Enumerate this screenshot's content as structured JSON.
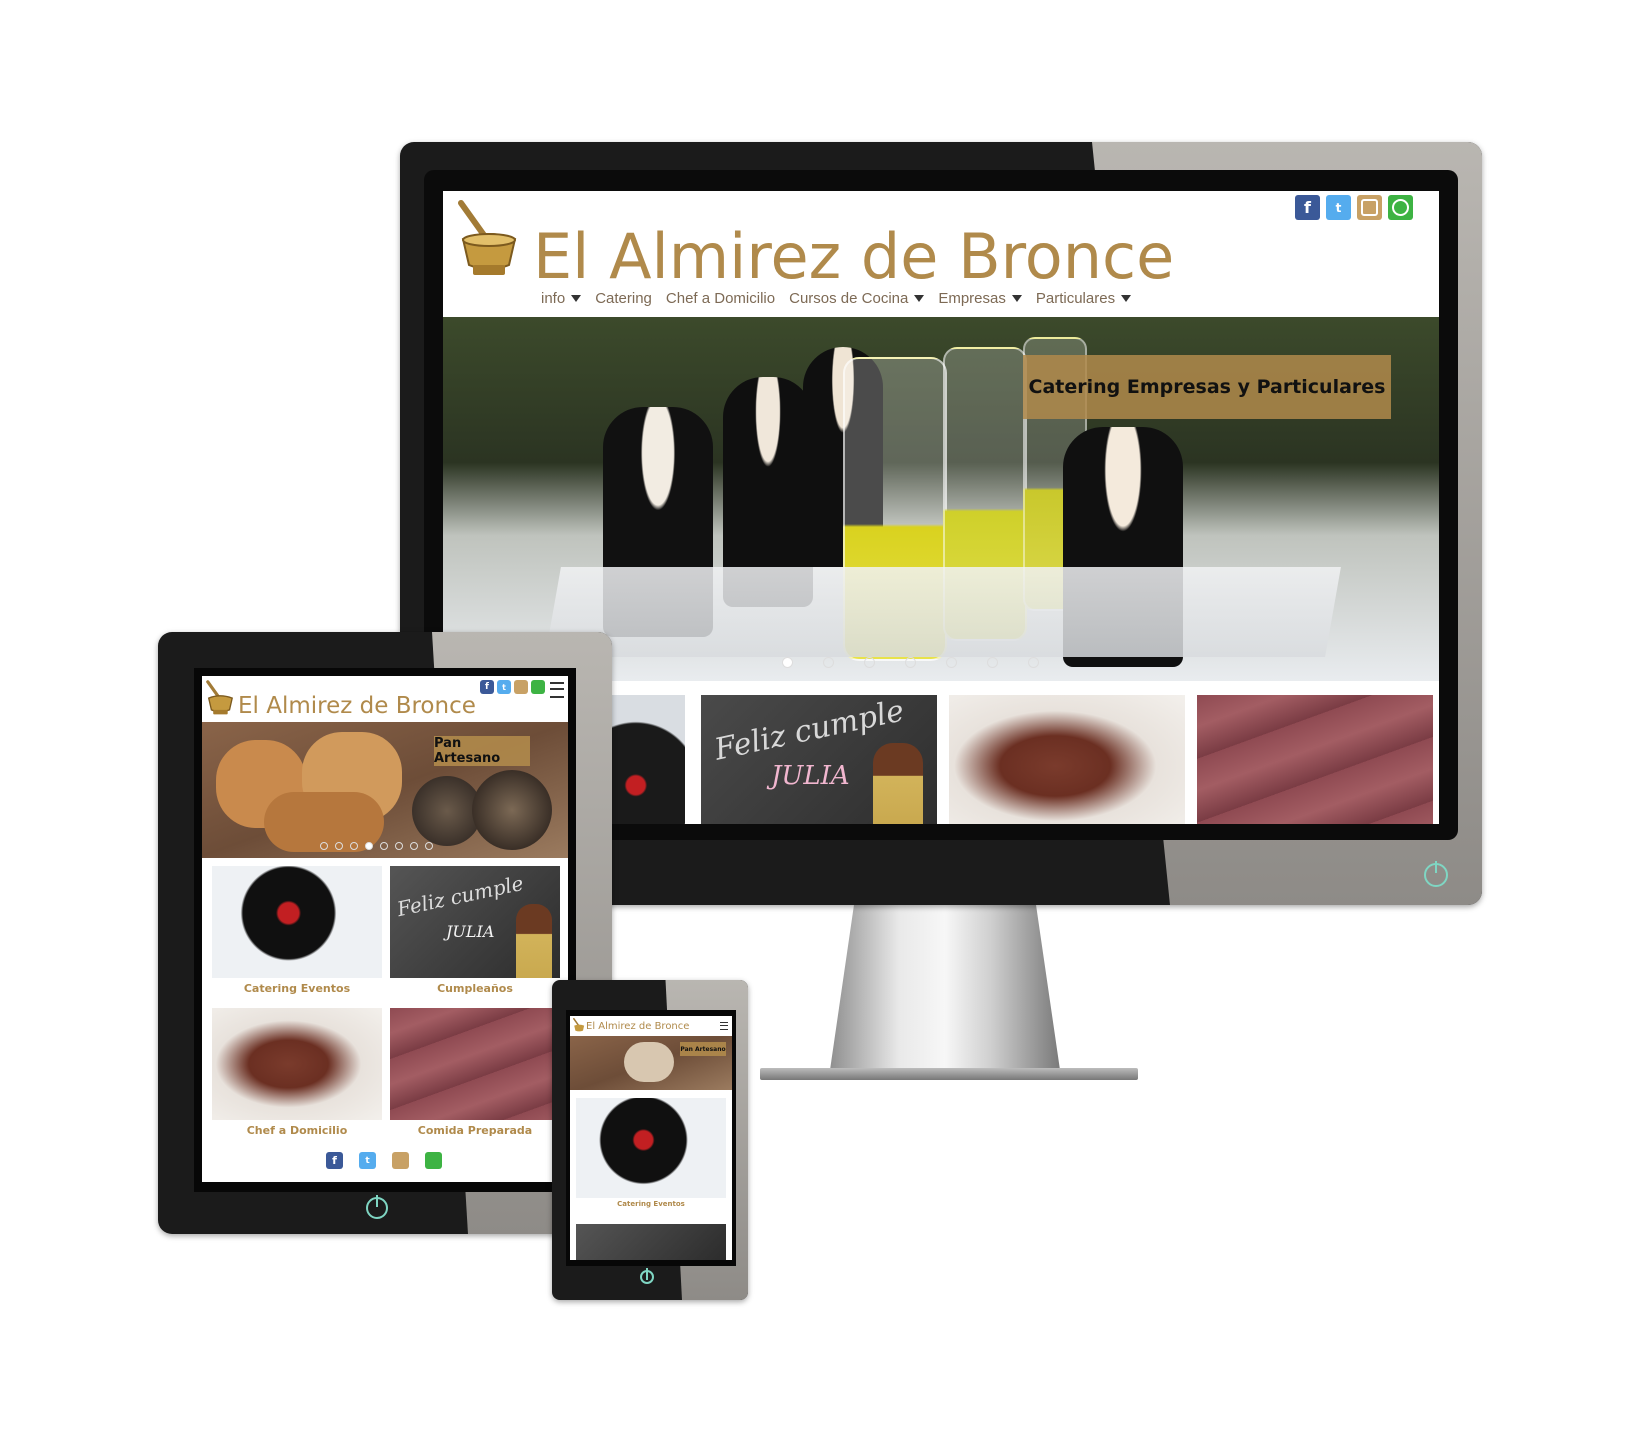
{
  "site": {
    "title": "El Almirez de Bronce",
    "brand_color": "#b08a4b"
  },
  "desktop": {
    "nav": [
      {
        "label": "info",
        "has_caret": true
      },
      {
        "label": "Catering",
        "has_caret": false
      },
      {
        "label": "Chef a Domicilio",
        "has_caret": false
      },
      {
        "label": "Cursos de Cocina",
        "has_caret": true
      },
      {
        "label": "Empresas",
        "has_caret": true
      },
      {
        "label": "Particulares",
        "has_caret": true
      }
    ],
    "social": [
      "f",
      "t",
      "ig",
      "wa"
    ],
    "slider": {
      "caption": "Catering Empresas y Particulares",
      "dots": 7,
      "active_dot": 1
    }
  },
  "tablet": {
    "slider": {
      "caption": "Pan Artesano",
      "dots": 8,
      "active_dot": 4
    },
    "tiles": [
      {
        "caption": "Catering Eventos"
      },
      {
        "caption": "Cumpleaños"
      },
      {
        "caption": "Chef a Domicilio"
      },
      {
        "caption": "Comida Preparada"
      }
    ]
  },
  "phone": {
    "slider": {
      "caption": "Pan Artesano"
    },
    "tiles": [
      {
        "caption": "Catering Eventos"
      }
    ]
  },
  "icons": {
    "facebook": "facebook-icon",
    "twitter": "twitter-icon",
    "instagram": "instagram-icon",
    "whatsapp": "whatsapp-icon",
    "menu": "hamburger-menu-icon",
    "power": "power-icon"
  }
}
